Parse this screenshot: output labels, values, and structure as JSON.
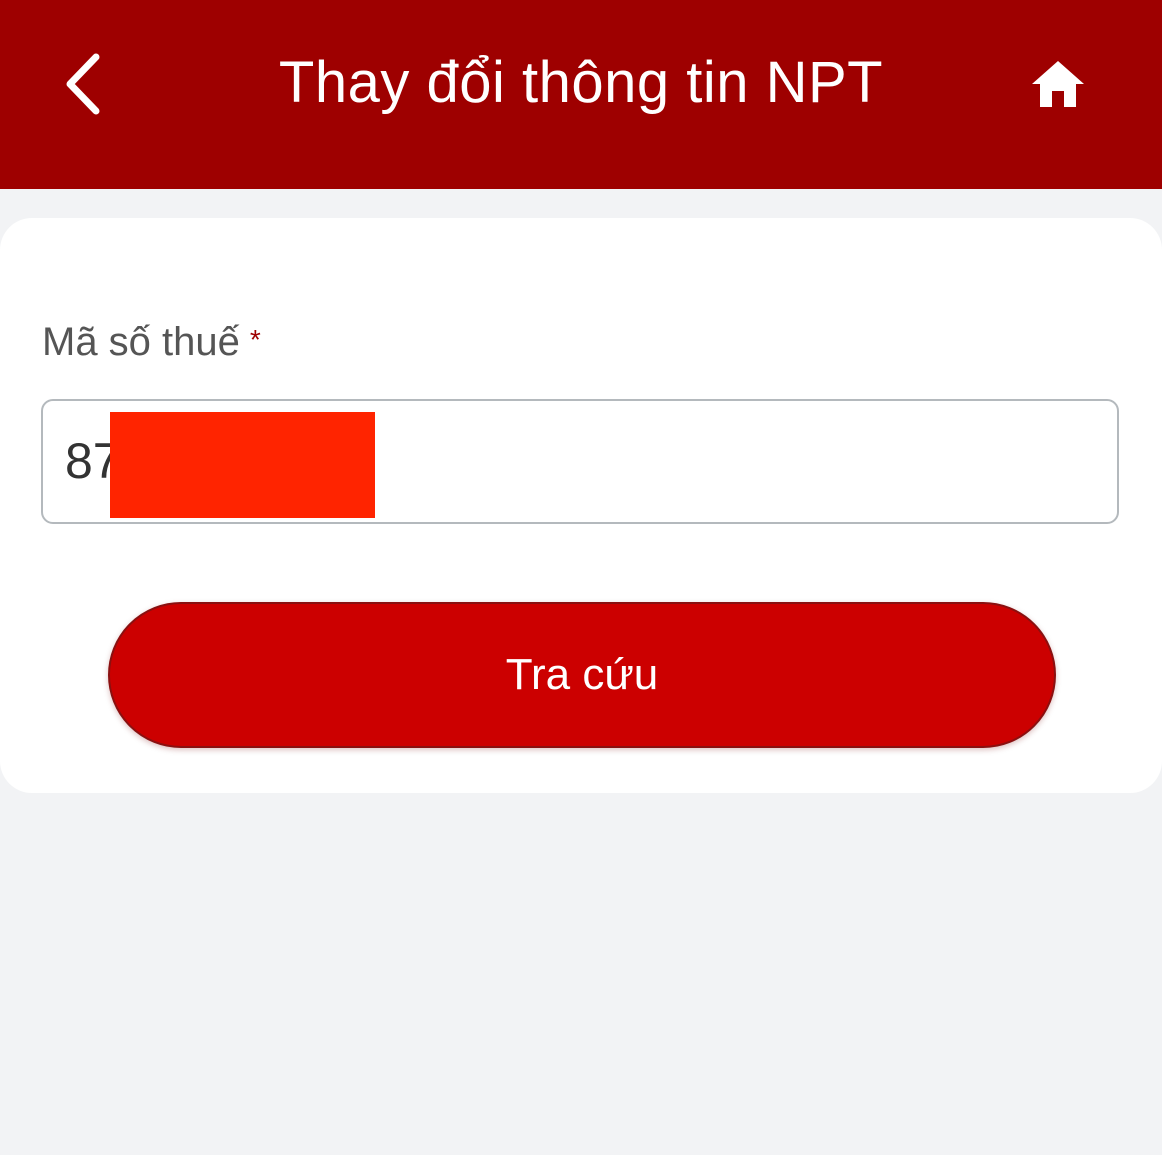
{
  "header": {
    "title": "Thay đổi thông tin NPT",
    "back_icon": "chevron-left-icon",
    "home_icon": "home-icon",
    "background_color": "#9e0000"
  },
  "form": {
    "tax_code": {
      "label": "Mã số thuế",
      "required_mark": "*",
      "value": "87"
    },
    "submit_label": "Tra cứu"
  },
  "colors": {
    "accent": "#cc0000",
    "page_background": "#f2f3f5"
  }
}
